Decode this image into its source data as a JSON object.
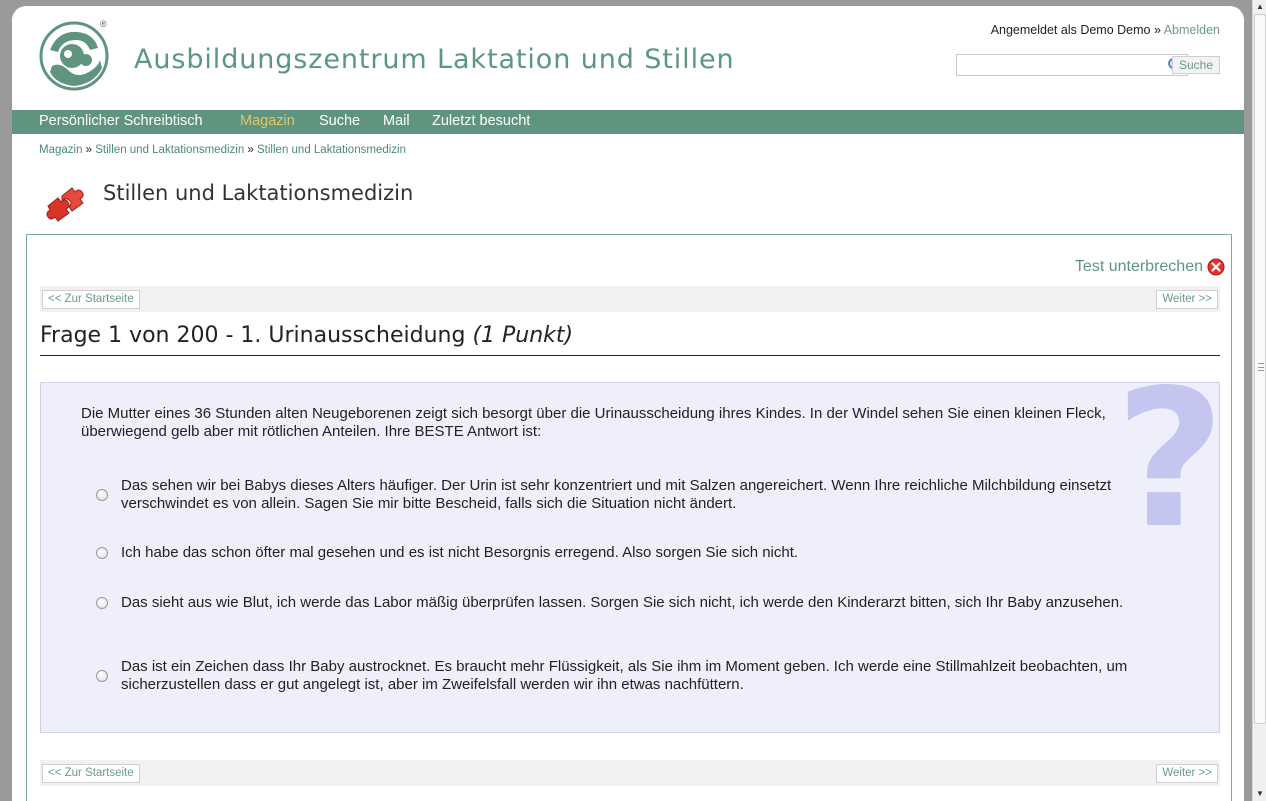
{
  "header": {
    "site_title": "Ausbildungszentrum Laktation und Stillen",
    "reg_mark": "®",
    "login_prefix": "Angemeldet als Demo Demo » ",
    "logout_label": "Abmelden",
    "search_value": "",
    "search_button": "Suche"
  },
  "nav": {
    "items": [
      {
        "label": "Persönlicher Schreibtisch",
        "active": false
      },
      {
        "label": "Magazin",
        "active": true
      },
      {
        "label": "Suche",
        "active": false
      },
      {
        "label": "Mail",
        "active": false
      },
      {
        "label": "Zuletzt besucht",
        "active": false
      }
    ]
  },
  "breadcrumb": {
    "items": [
      "Magazin",
      "Stillen und Laktationsmedizin",
      "Stillen und Laktationsmedizin"
    ],
    "separator": " » "
  },
  "section": {
    "title": "Stillen und Laktationsmedizin",
    "icon": "puzzle-icon"
  },
  "test": {
    "interrupt_label": "Test unterbrechen",
    "back_label": "<< Zur Startseite",
    "next_label": "Weiter >>",
    "heading_main": "Frage 1 von 200 - 1. Urinausscheidung ",
    "heading_points": "(1 Punkt)",
    "question": "Die Mutter eines 36 Stunden alten Neugeborenen zeigt sich besorgt über die Urinausscheidung ihres Kindes. In der Windel sehen Sie einen kleinen Fleck, überwiegend gelb aber mit rötlichen Anteilen. Ihre BESTE Antwort ist:",
    "answers": [
      "Das sehen wir bei Babys dieses Alters häufiger. Der Urin ist sehr konzentriert und mit Salzen angereichert. Wenn Ihre reichliche Milchbildung einsetzt verschwindet es von allein. Sagen Sie mir bitte Bescheid, falls sich die Situation nicht ändert.",
      "Ich habe das schon öfter mal gesehen und es ist nicht Besorgnis erregend. Also sorgen Sie sich nicht.",
      "Das sieht aus wie Blut, ich werde das Labor mäßig überprüfen lassen. Sorgen Sie sich nicht, ich werde den Kinderarzt bitten, sich Ihr Baby anzusehen.",
      "Das ist ein Zeichen dass Ihr Baby austrocknet. Es braucht mehr Flüssigkeit, als Sie ihm im Moment geben. Ich werde eine Stillmahlzeit beobachten, um sicherzustellen dass er gut angelegt ist, aber im Zweifelsfall werden wir ihn etwas nachfüttern."
    ],
    "qmark_glyph": "?"
  },
  "colors": {
    "brand_green": "#5f957f",
    "nav_active": "#e0c66a",
    "question_bg": "#eeeffb",
    "qmark": "#c4c6ef"
  }
}
